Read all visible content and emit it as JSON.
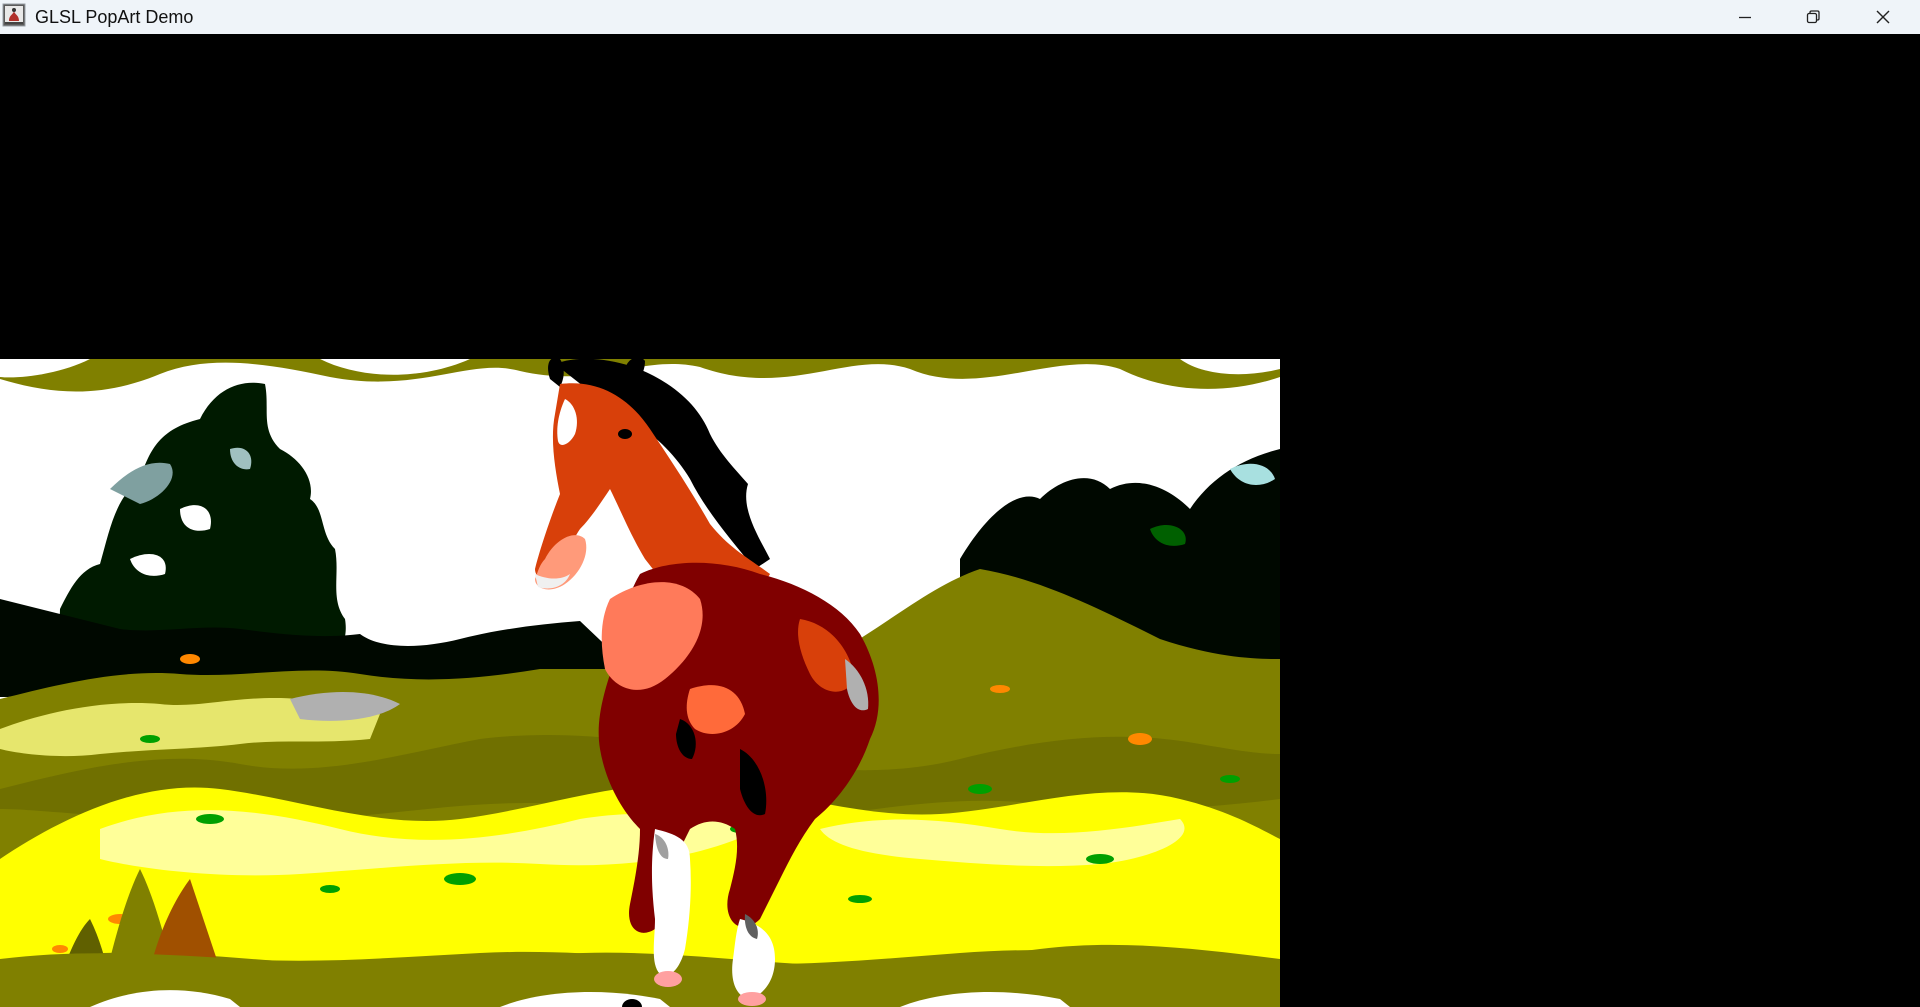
{
  "window": {
    "title": "GLSL PopArt Demo",
    "app_icon": "java-app-icon",
    "controls": [
      {
        "name": "minimize-icon"
      },
      {
        "name": "restore-icon"
      },
      {
        "name": "close-icon"
      }
    ]
  },
  "canvas": {
    "content": "pop-art-horse-render",
    "palette": {
      "sky": "#ffffff",
      "olive": "#808000",
      "yellow": "#ffff00",
      "light_yellow": "#ffff88",
      "dark_red": "#800000",
      "orange_red": "#d8400a",
      "orange": "#ff8800",
      "green": "#00c000",
      "black": "#000000"
    }
  }
}
